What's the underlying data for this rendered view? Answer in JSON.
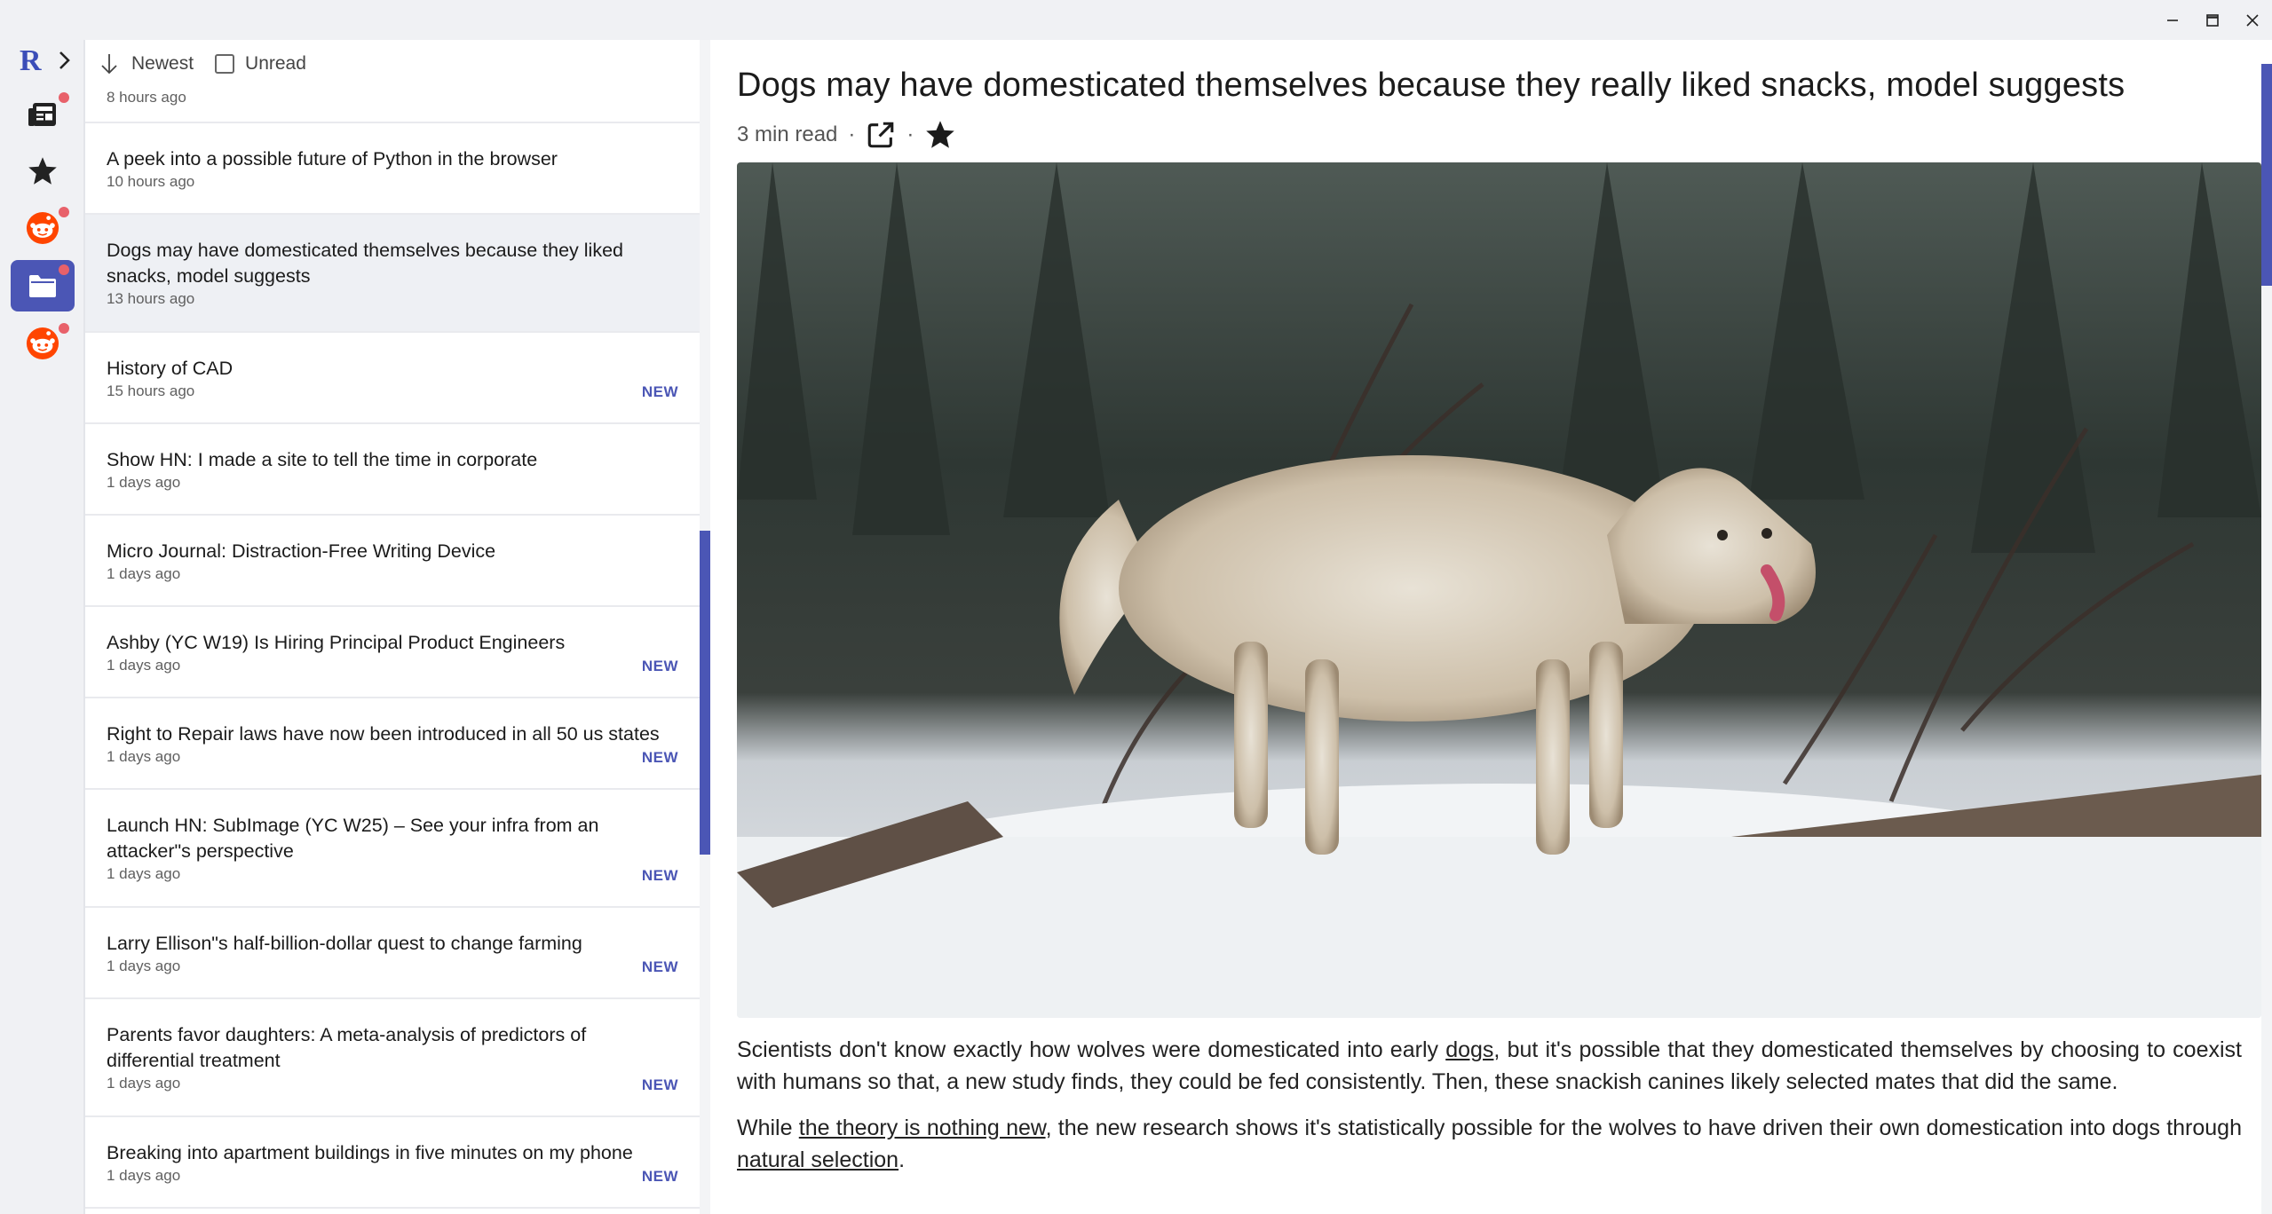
{
  "window": {
    "controls": [
      "minimize",
      "maximize",
      "close"
    ]
  },
  "rail": {
    "logo": "R",
    "buttons": [
      {
        "name": "articles",
        "icon": "newspaper-icon",
        "badge": true
      },
      {
        "name": "starred",
        "icon": "star-icon",
        "badge": false
      },
      {
        "name": "reddit-feed-1",
        "icon": "reddit-icon",
        "badge": true
      },
      {
        "name": "folder",
        "icon": "folder-icon",
        "badge": true,
        "active": true
      },
      {
        "name": "reddit-feed-2",
        "icon": "reddit-icon",
        "badge": true
      }
    ]
  },
  "toolbar": {
    "sort_label": "Newest",
    "unread_label": "Unread",
    "unread_checked": false
  },
  "list": {
    "partial_time": "8 hours ago",
    "items": [
      {
        "title": "A peek into a possible future of Python in the browser",
        "time": "10 hours ago",
        "new": ""
      },
      {
        "title": "Dogs may have domesticated themselves because they liked snacks, model suggests",
        "time": "13 hours ago",
        "new": "",
        "selected": true
      },
      {
        "title": "History of CAD",
        "time": "15 hours ago",
        "new": "NEW"
      },
      {
        "title": "Show HN: I made a site to tell the time in corporate",
        "time": "1 days ago",
        "new": ""
      },
      {
        "title": "Micro Journal: Distraction-Free Writing Device",
        "time": "1 days ago",
        "new": ""
      },
      {
        "title": "Ashby (YC W19) Is Hiring Principal Product Engineers",
        "time": "1 days ago",
        "new": "NEW"
      },
      {
        "title": "Right to Repair laws have now been introduced in all 50 us states",
        "time": "1 days ago",
        "new": "NEW"
      },
      {
        "title": "Launch HN: SubImage (YC W25) – See your infra from an attacker\"s perspective",
        "time": "1 days ago",
        "new": "NEW"
      },
      {
        "title": "Larry Ellison\"s half-billion-dollar quest to change farming",
        "time": "1 days ago",
        "new": "NEW"
      },
      {
        "title": "Parents favor daughters: A meta-analysis of predictors of differential treatment",
        "time": "1 days ago",
        "new": "NEW"
      },
      {
        "title": "Breaking into apartment buildings in five minutes on my phone",
        "time": "1 days ago",
        "new": "NEW"
      }
    ]
  },
  "article": {
    "title": "Dogs may have domesticated themselves because they really liked snacks, model suggests",
    "read_time": "3 min read",
    "dot": "·",
    "paragraph1": {
      "a": "Scientists don't know exactly how wolves were domesticated into early ",
      "link1": "dogs",
      "b": ", but it's possible that they domesticated themselves by choosing to coexist with humans so that, a new study finds, they could be fed consistently. Then, these snackish canines likely selected mates that did the same."
    },
    "paragraph2": {
      "a": "While ",
      "link1": "the theory is nothing new",
      "b": ", the new research shows it's statistically possible for the wolves to have driven their own domestication into dogs through ",
      "link2": "natural selection",
      "c": "."
    }
  },
  "colors": {
    "accent": "#4b56b5",
    "badge": "#e8616a"
  }
}
